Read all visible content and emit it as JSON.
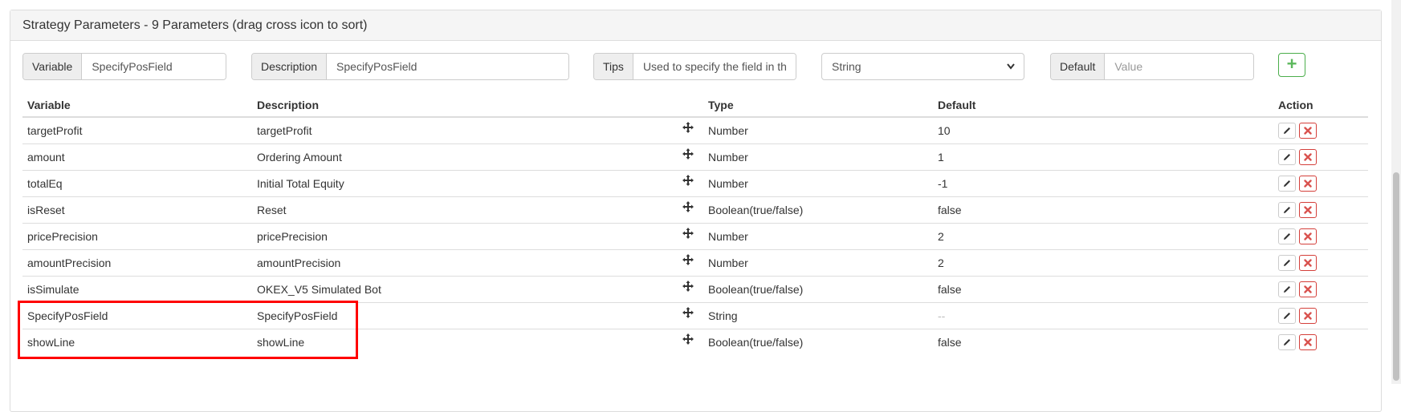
{
  "panel": {
    "title": "Strategy Parameters - 9 Parameters (drag cross icon to sort)"
  },
  "form": {
    "variable_label": "Variable",
    "variable_value": "SpecifyPosField",
    "description_label": "Description",
    "description_value": "SpecifyPosField",
    "tips_label": "Tips",
    "tips_value": "Used to specify the field in th",
    "type_selected": "String",
    "default_label": "Default",
    "default_placeholder": "Value",
    "add_button_label": "+"
  },
  "table": {
    "headers": {
      "variable": "Variable",
      "description": "Description",
      "type": "Type",
      "default": "Default",
      "action": "Action"
    },
    "rows": [
      {
        "variable": "targetProfit",
        "description": "targetProfit",
        "type": "Number",
        "default": "10"
      },
      {
        "variable": "amount",
        "description": "Ordering Amount",
        "type": "Number",
        "default": "1"
      },
      {
        "variable": "totalEq",
        "description": "Initial Total Equity",
        "type": "Number",
        "default": "-1"
      },
      {
        "variable": "isReset",
        "description": "Reset",
        "type": "Boolean(true/false)",
        "default": "false"
      },
      {
        "variable": "pricePrecision",
        "description": "pricePrecision",
        "type": "Number",
        "default": "2"
      },
      {
        "variable": "amountPrecision",
        "description": "amountPrecision",
        "type": "Number",
        "default": "2"
      },
      {
        "variable": "isSimulate",
        "description": "OKEX_V5 Simulated Bot",
        "type": "Boolean(true/false)",
        "default": "false"
      },
      {
        "variable": "SpecifyPosField",
        "description": "SpecifyPosField",
        "type": "String",
        "default": "--"
      },
      {
        "variable": "showLine",
        "description": "showLine",
        "type": "Boolean(true/false)",
        "default": "false"
      }
    ]
  },
  "icons": {
    "move": "move-cross-icon",
    "edit": "pencil-icon",
    "delete": "close-x-icon",
    "dropdown": "chevron-down-icon"
  },
  "colors": {
    "highlight": "#ff0000",
    "add_green": "#5cb85c",
    "delete_red": "#d9534f",
    "heading_bg": "#f5f5f5"
  }
}
